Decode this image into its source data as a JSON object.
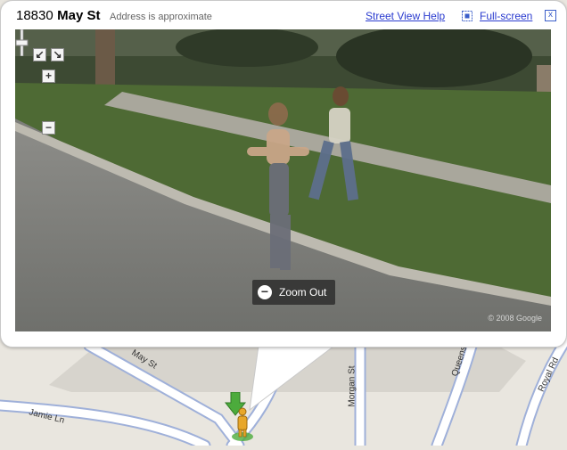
{
  "header": {
    "address_number": "18830",
    "address_street": "May St",
    "address_note": "Address is approximate",
    "street_view_help": "Street View Help",
    "fullscreen": "Full-screen",
    "close": "x"
  },
  "pano": {
    "zoom_in": "+",
    "zoom_out": "−",
    "overlay_zoom_out": "Zoom Out",
    "copyright": "© 2008 Google"
  },
  "map": {
    "roads": [
      "May St",
      "Jamie Ln",
      "Morgan St",
      "Queens",
      "Royal Rd"
    ]
  },
  "colors": {
    "link": "#2a3bcf",
    "road_fill": "#ffffff",
    "road_edge": "#9fb0d9",
    "map_bg": "#e9e6df",
    "pegman": "#e8a72a",
    "arrow": "#4cab3c"
  }
}
